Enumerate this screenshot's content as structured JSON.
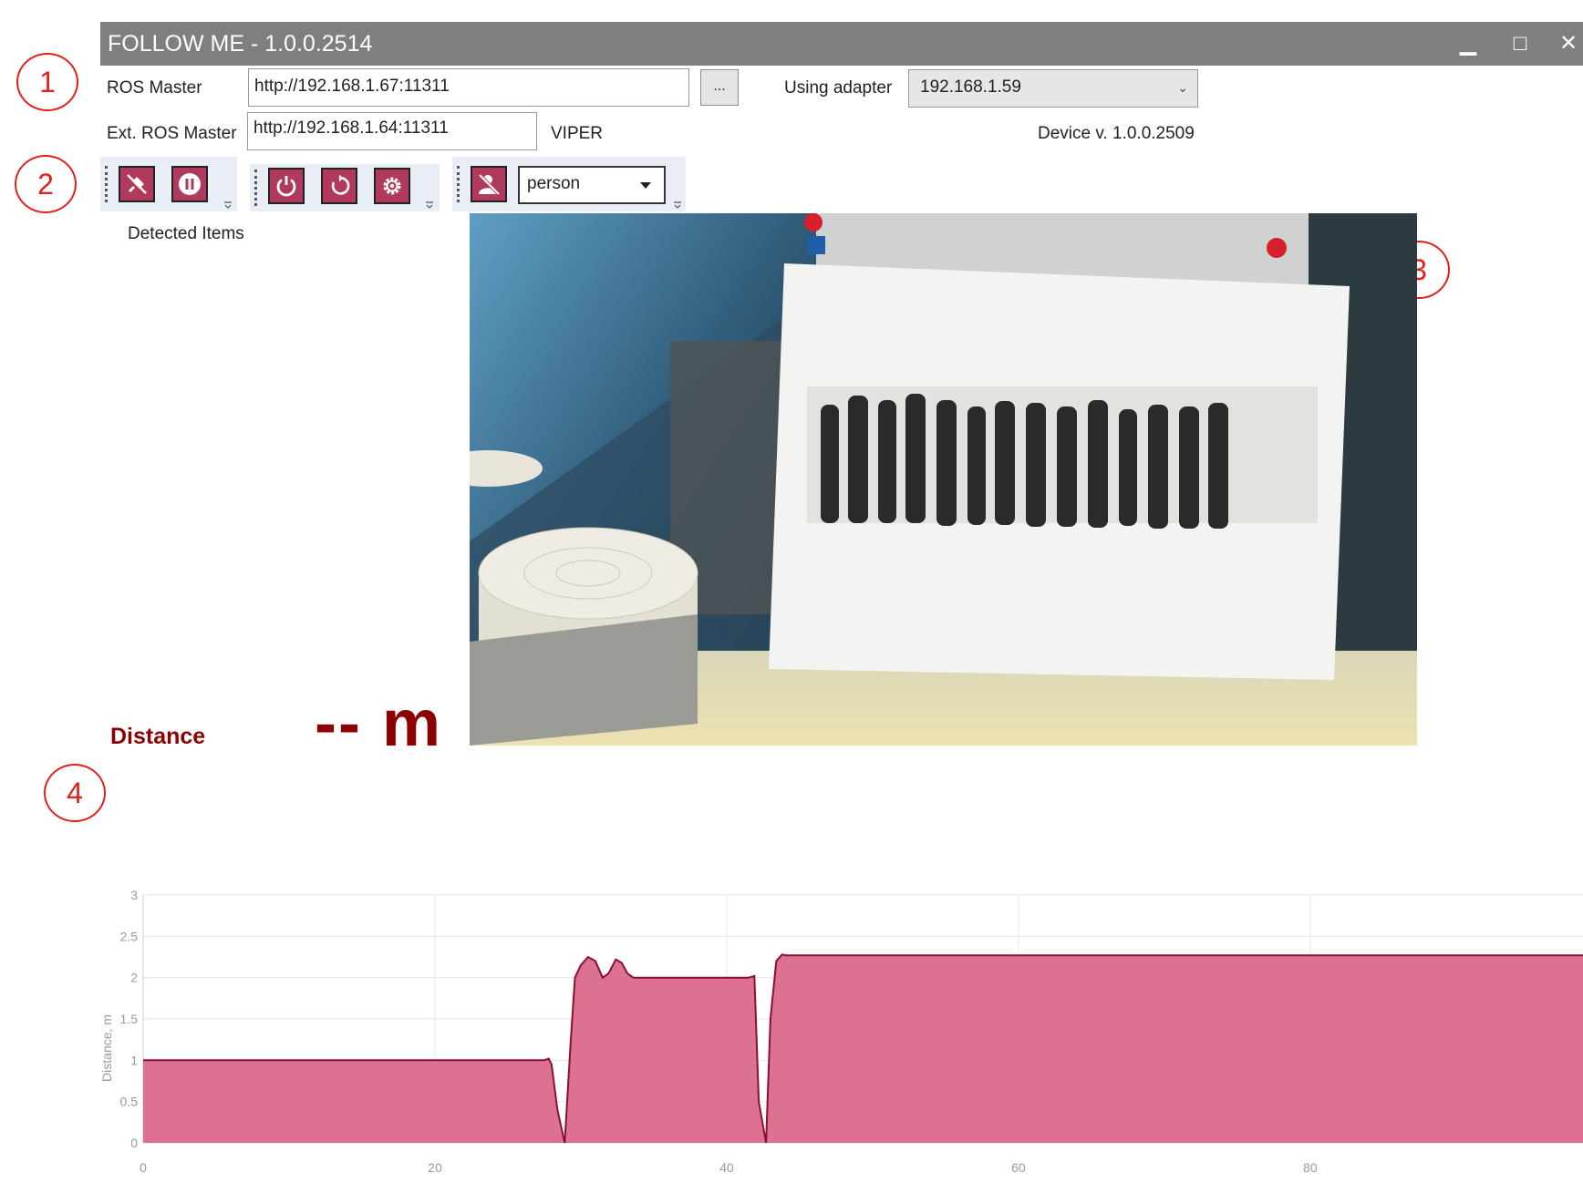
{
  "window": {
    "title": "FOLLOW ME - 1.0.0.2514",
    "minimize_glyph": "▁",
    "maximize_glyph": "□",
    "close_glyph": "✕"
  },
  "connection": {
    "ros_master_label": "ROS Master",
    "ros_master_value": "http://192.168.1.67:11311",
    "browse_label": "...",
    "adapter_label": "Using adapter",
    "adapter_value": "192.168.1.59",
    "ext_ros_master_label": "Ext. ROS Master",
    "ext_ros_master_value": "http://192.168.1.64:11311",
    "robot_name": "VIPER",
    "device_version": "Device v. 1.0.0.2509"
  },
  "toolbar": {
    "groups": [
      {
        "buttons": [
          {
            "icon": "disconnect-icon"
          },
          {
            "icon": "pause-icon"
          }
        ]
      },
      {
        "buttons": [
          {
            "icon": "power-icon"
          },
          {
            "icon": "reset-icon"
          },
          {
            "icon": "settings-icon"
          }
        ]
      },
      {
        "buttons": [
          {
            "icon": "person-off-icon"
          }
        ]
      }
    ],
    "target_class": "person"
  },
  "detected_items_label": "Detected Items",
  "distance": {
    "label": "Distance",
    "value": "-- m"
  },
  "annotations": [
    "1",
    "2",
    "3",
    "4"
  ],
  "colors": {
    "titlebar": "#7f7f7f",
    "accent": "#b03a5b",
    "distance_text": "#8b0000",
    "chart_fill": "#dc7191",
    "chart_line": "#8b1030",
    "annotation": "#e0201b"
  },
  "chart_data": {
    "type": "area",
    "ylabel": "Distance, m",
    "xlabel": "",
    "xlim": [
      0,
      98.7
    ],
    "ylim": [
      0,
      3
    ],
    "x_ticks": [
      "0",
      "20",
      "40",
      "60",
      "80"
    ],
    "y_ticks": [
      "0",
      "0.5",
      "1",
      "1.5",
      "2",
      "2.5",
      "3"
    ],
    "grid": true,
    "series": [
      {
        "x": [
          0,
          27.5,
          27.8,
          28.0,
          28.4,
          28.9,
          29.3,
          29.6,
          30.0,
          30.5,
          31.0,
          31.5,
          31.9,
          32.4,
          32.8,
          33.2,
          33.6,
          34.0,
          35.0,
          40.0,
          41.5,
          41.9,
          42.2,
          42.7,
          43.0,
          43.4,
          43.8,
          44.1,
          44.5,
          98.7
        ],
        "y": [
          1.0,
          1.0,
          1.02,
          0.95,
          0.4,
          0.0,
          1.2,
          2.0,
          2.15,
          2.25,
          2.2,
          2.0,
          2.05,
          2.22,
          2.18,
          2.05,
          2.0,
          2.0,
          2.0,
          2.0,
          2.0,
          2.02,
          0.5,
          0.0,
          1.5,
          2.2,
          2.28,
          2.27,
          2.27,
          2.27
        ]
      }
    ]
  }
}
